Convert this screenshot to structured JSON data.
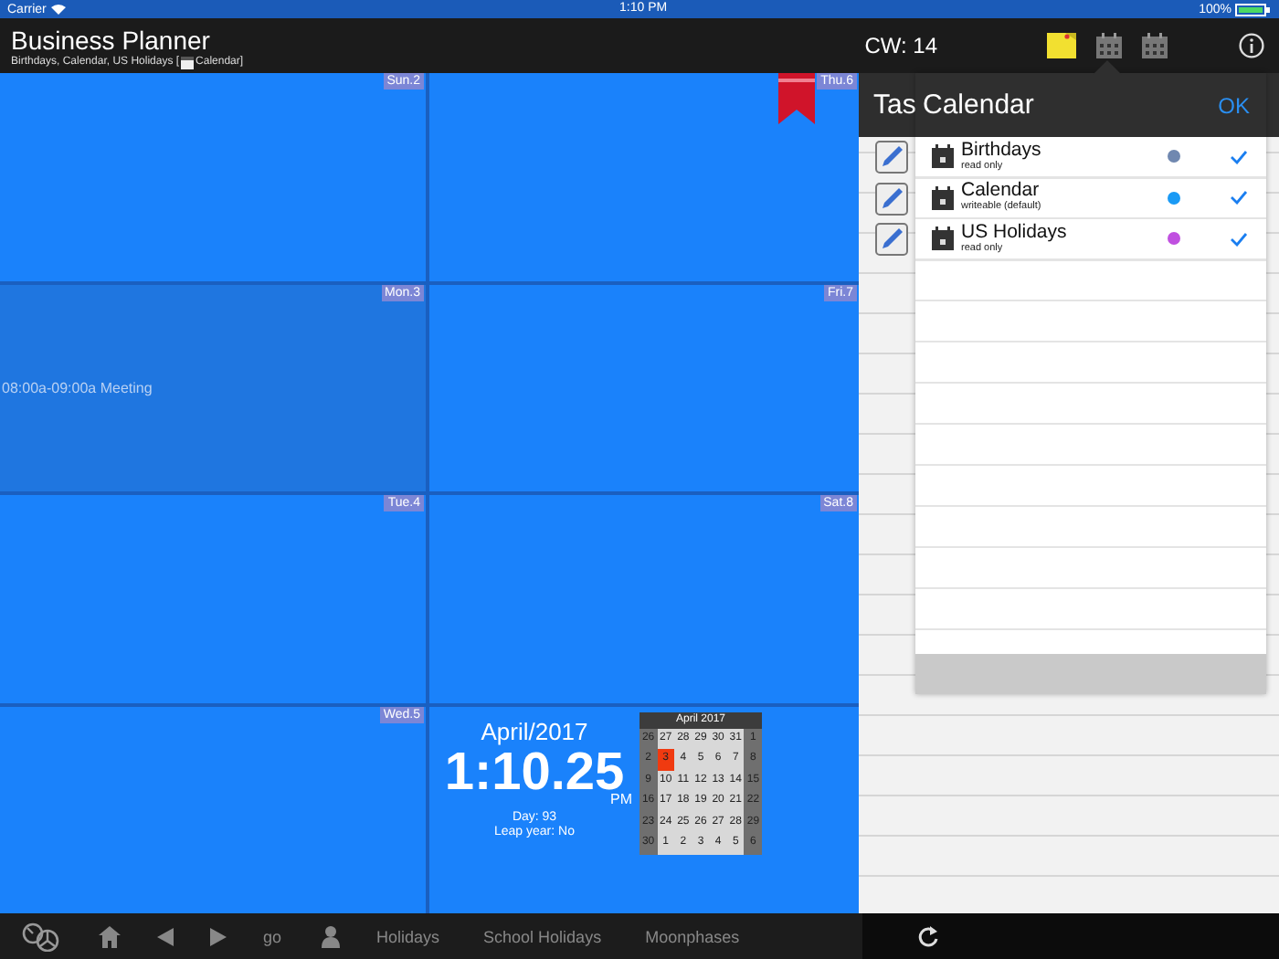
{
  "status_bar": {
    "carrier": "Carrier",
    "time": "1:10 PM",
    "battery": "100%"
  },
  "header": {
    "title": "Business Planner",
    "subtitle_before": "Birthdays, Calendar, US Holidays [",
    "subtitle_after": "Calendar]",
    "week": "CW: 14"
  },
  "cells": [
    {
      "kind": "day",
      "label": "Sun.2",
      "selected": false,
      "bookmark": false
    },
    {
      "kind": "day",
      "label": "Thu.6",
      "selected": false,
      "bookmark": true
    },
    {
      "kind": "day",
      "label": "Mon.3",
      "selected": true,
      "bookmark": false,
      "events": [
        "08:00a-09:00a  Meeting"
      ]
    },
    {
      "kind": "day",
      "label": "Fri.7",
      "selected": false,
      "bookmark": false
    },
    {
      "kind": "day",
      "label": "Tue.4",
      "selected": false,
      "bookmark": false
    },
    {
      "kind": "day",
      "label": "Sat.8",
      "selected": false,
      "bookmark": false
    },
    {
      "kind": "day",
      "label": "Wed.5",
      "selected": false,
      "bookmark": false
    },
    {
      "kind": "clock",
      "month": "April/2017",
      "time": "1:10.25",
      "ampm": "PM",
      "day": "Day: 93",
      "leap": "Leap year: No"
    }
  ],
  "mini_calendar": {
    "title": "April 2017",
    "rows": [
      [
        {
          "d": "26",
          "selected": false
        },
        {
          "d": "27",
          "selected": false
        },
        {
          "d": "28",
          "selected": false
        },
        {
          "d": "29",
          "selected": false
        },
        {
          "d": "30",
          "selected": false
        },
        {
          "d": "31",
          "selected": false
        },
        {
          "d": "1",
          "selected": false
        }
      ],
      [
        {
          "d": "2",
          "selected": false
        },
        {
          "d": "3",
          "selected": true
        },
        {
          "d": "4",
          "selected": false
        },
        {
          "d": "5",
          "selected": false
        },
        {
          "d": "6",
          "selected": false
        },
        {
          "d": "7",
          "selected": false
        },
        {
          "d": "8",
          "selected": false
        }
      ],
      [
        {
          "d": "9",
          "selected": false
        },
        {
          "d": "10",
          "selected": false
        },
        {
          "d": "11",
          "selected": false
        },
        {
          "d": "12",
          "selected": false
        },
        {
          "d": "13",
          "selected": false
        },
        {
          "d": "14",
          "selected": false
        },
        {
          "d": "15",
          "selected": false
        }
      ],
      [
        {
          "d": "16",
          "selected": false
        },
        {
          "d": "17",
          "selected": false
        },
        {
          "d": "18",
          "selected": false
        },
        {
          "d": "19",
          "selected": false
        },
        {
          "d": "20",
          "selected": false
        },
        {
          "d": "21",
          "selected": false
        },
        {
          "d": "22",
          "selected": false
        }
      ],
      [
        {
          "d": "23",
          "selected": false
        },
        {
          "d": "24",
          "selected": false
        },
        {
          "d": "25",
          "selected": false
        },
        {
          "d": "26",
          "selected": false
        },
        {
          "d": "27",
          "selected": false
        },
        {
          "d": "28",
          "selected": false
        },
        {
          "d": "29",
          "selected": false
        }
      ],
      [
        {
          "d": "30",
          "selected": false
        },
        {
          "d": "1",
          "selected": false
        },
        {
          "d": "2",
          "selected": false
        },
        {
          "d": "3",
          "selected": false
        },
        {
          "d": "4",
          "selected": false
        },
        {
          "d": "5",
          "selected": false
        },
        {
          "d": "6",
          "selected": false
        }
      ]
    ]
  },
  "tasks": {
    "title": "Tas"
  },
  "popover": {
    "title": "Calendar",
    "ok": "OK",
    "calendars": [
      {
        "name": "Birthdays",
        "note": "read only",
        "color": "#7088b0",
        "checked": true
      },
      {
        "name": "Calendar",
        "note": "writeable (default)",
        "color": "#1a9af5",
        "checked": true
      },
      {
        "name": "US Holidays",
        "note": "read only",
        "color": "#c050e0",
        "checked": true
      }
    ]
  },
  "toolbar": {
    "go": "go",
    "labels": [
      "Holidays",
      "School Holidays",
      "Moonphases"
    ]
  }
}
